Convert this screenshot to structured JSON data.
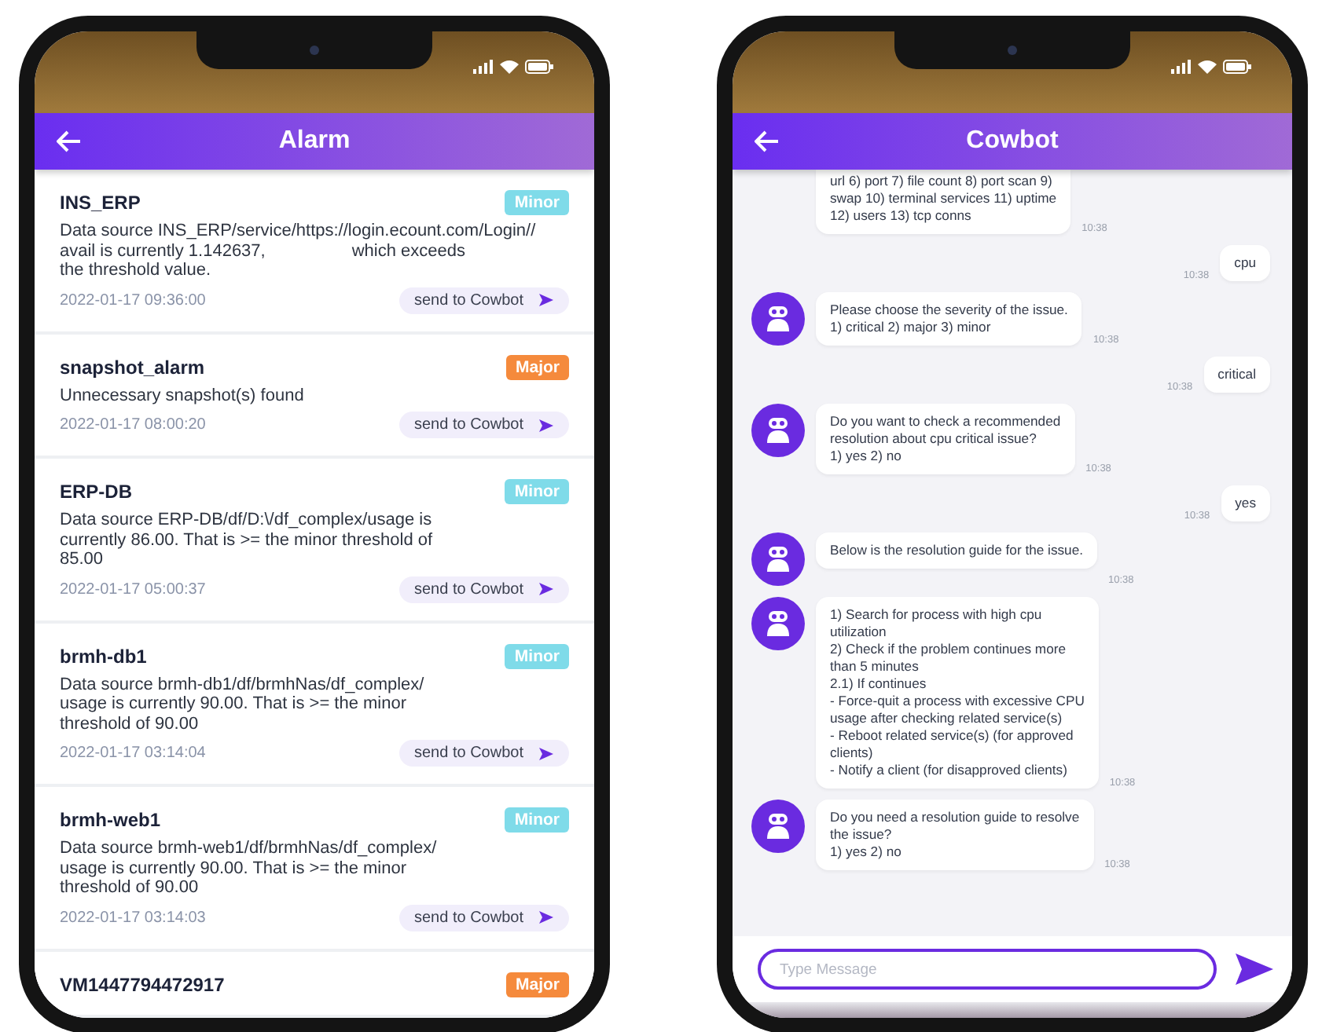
{
  "alarm_screen": {
    "title": "Alarm",
    "alarms": [
      {
        "name": "INS_ERP",
        "severity": "Minor",
        "color": "#7fdbe9",
        "message": "Data source INS_ERP/service/https://login.ecount.com/Login//\navail is currently 1.142637,                  which exceeds\nthe threshold value.",
        "time": "2022-01-17 09:36:00",
        "action": "send to Cowbot"
      },
      {
        "name": "snapshot_alarm",
        "severity": "Major",
        "color": "#f58a3c",
        "message": "Unnecessary snapshot(s) found",
        "time": "2022-01-17 08:00:20",
        "action": "send to Cowbot"
      },
      {
        "name": "ERP-DB",
        "severity": "Minor",
        "color": "#7fdbe9",
        "message": "Data source ERP-DB/df/D:\\/df_complex/usage is\ncurrently 86.00. That is >= the minor threshold of\n85.00",
        "time": "2022-01-17 05:00:37",
        "action": "send to Cowbot"
      },
      {
        "name": "brmh-db1",
        "severity": "Minor",
        "color": "#7fdbe9",
        "message": "Data source brmh-db1/df/brmhNas/df_complex/\nusage is currently 90.00. That is >= the minor\nthreshold of 90.00",
        "time": "2022-01-17 03:14:04",
        "action": "send to Cowbot"
      },
      {
        "name": "brmh-web1",
        "severity": "Minor",
        "color": "#7fdbe9",
        "message": "Data source brmh-web1/df/brmhNas/df_complex/\nusage is currently 90.00. That is >= the minor\nthreshold of 90.00",
        "time": "2022-01-17 03:14:03",
        "action": "send to Cowbot"
      },
      {
        "name": "VM1447794472917",
        "severity": "Major",
        "color": "#f58a3c"
      }
    ]
  },
  "chat_screen": {
    "title": "Cowbot",
    "messages": [
      {
        "kind": "bot_partial",
        "text": "url  6) port  7) file count  8) port scan  9)\nswap  10) terminal services  11) uptime\n12) users  13) tcp conns",
        "time": "10:38"
      },
      {
        "kind": "user",
        "text": "cpu",
        "time": "10:38"
      },
      {
        "kind": "bot",
        "text": "Please choose the severity of the issue.\n1) critical  2) major  3) minor",
        "time": "10:38"
      },
      {
        "kind": "user",
        "text": "critical",
        "time": "10:38"
      },
      {
        "kind": "bot",
        "text": "Do you want to check a recommended\nresolution about cpu critical issue?\n1) yes  2) no",
        "time": "10:38"
      },
      {
        "kind": "user",
        "text": "yes",
        "time": "10:38"
      },
      {
        "kind": "bot",
        "text": "Below is the resolution guide for the issue.",
        "time": "10:38"
      },
      {
        "kind": "bot",
        "text": "1) Search for process with high cpu\nutilization\n2) Check if the problem continues more\nthan 5 minutes\n 2.1) If continues\n- Force-quit a process with excessive CPU\nusage after checking related service(s)\n- Reboot related service(s) (for approved\nclients)\n- Notify a client (for disapproved clients)",
        "time": "10:38"
      },
      {
        "kind": "bot",
        "text": "Do you need a resolution guide to resolve\nthe issue?\n1) yes  2) no",
        "time": "10:38"
      }
    ],
    "input": {
      "placeholder": "Type Message"
    }
  }
}
